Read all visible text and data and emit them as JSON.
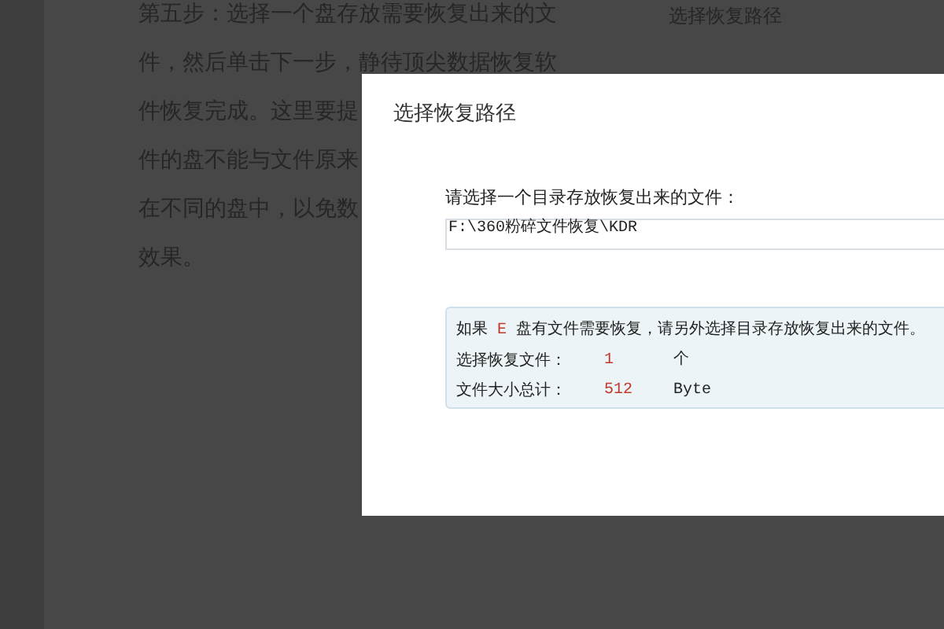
{
  "article": {
    "lines": [
      "第五步：选择一个盘存放需要恢复出来的文",
      "件，然后单击下一步，静待顶尖数据恢复软",
      "件恢复完成。这里要提",
      "件的盘不能与文件原来",
      "在不同的盘中，以免数",
      "效果。"
    ]
  },
  "sidebar": {
    "title": "选择恢复路径"
  },
  "dialog": {
    "title": "选择恢复路径",
    "path_label": "请选择一个目录存放恢复出来的文件：",
    "path_value": "F:\\360粉碎文件恢复\\KDR",
    "notice": {
      "prefix": "如果",
      "drive": "E",
      "suffix": "盘有文件需要恢复，请另外选择目录存放恢复出来的文件。"
    },
    "stats": [
      {
        "label": "选择恢复文件：",
        "value": "1",
        "unit": "个"
      },
      {
        "label": "文件大小总计：",
        "value": "512",
        "unit": "Byte"
      }
    ]
  }
}
